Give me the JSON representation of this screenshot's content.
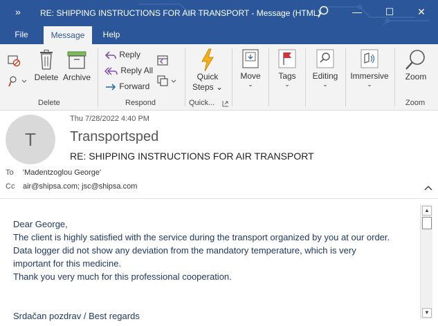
{
  "window": {
    "title": "RE: SHIPPING INSTRUCTIONS FOR AIR TRANSPORT  -  Message (HTML)",
    "quick_access_glyph": "»",
    "minimize_glyph": "—",
    "maximize_glyph": "☐",
    "close_glyph": "✕"
  },
  "tabs": [
    {
      "label": "File"
    },
    {
      "label": "Message",
      "active": true
    },
    {
      "label": "Help"
    }
  ],
  "ribbon": {
    "delete": {
      "delete_label": "Delete",
      "archive_label": "Archive",
      "group_label": "Delete"
    },
    "respond": {
      "reply_label": "Reply",
      "reply_all_label": "Reply All",
      "forward_label": "Forward",
      "group_label": "Respond"
    },
    "quick": {
      "quick_steps_label_1": "Quick",
      "quick_steps_label_2": "Steps",
      "group_label": "Quick..."
    },
    "move": {
      "label": "Move"
    },
    "tags": {
      "label": "Tags"
    },
    "editing": {
      "label": "Editing"
    },
    "immersive": {
      "label": "Immersive"
    },
    "zoom": {
      "label": "Zoom",
      "group_label": "Zoom"
    }
  },
  "message": {
    "avatar_letter": "T",
    "date": "Thu 7/28/2022 4:40 PM",
    "sender": "Transportsped",
    "subject": "RE: SHIPPING INSTRUCTIONS FOR AIR TRANSPORT",
    "to_label": "To",
    "to_value": "'Madentzoglou George'",
    "cc_label": "Cc",
    "cc_value": "air@shipsa.com; jsc@shipsa.com"
  },
  "body": {
    "lines": [
      "Dear George,",
      "The client is highly satisfied with the service during the transport organized by you at our order.",
      "Data logger did not show any deviation from the mandatory temperature, which is very",
      "important for this medicine.",
      "Thank you very much for this professional cooperation.",
      "",
      "",
      "Srdačan pozdrav / Best regards"
    ]
  },
  "colors": {
    "titlebar": "#2b579a",
    "ribbon": "#f3f3f3",
    "body_text": "#1f3864"
  }
}
